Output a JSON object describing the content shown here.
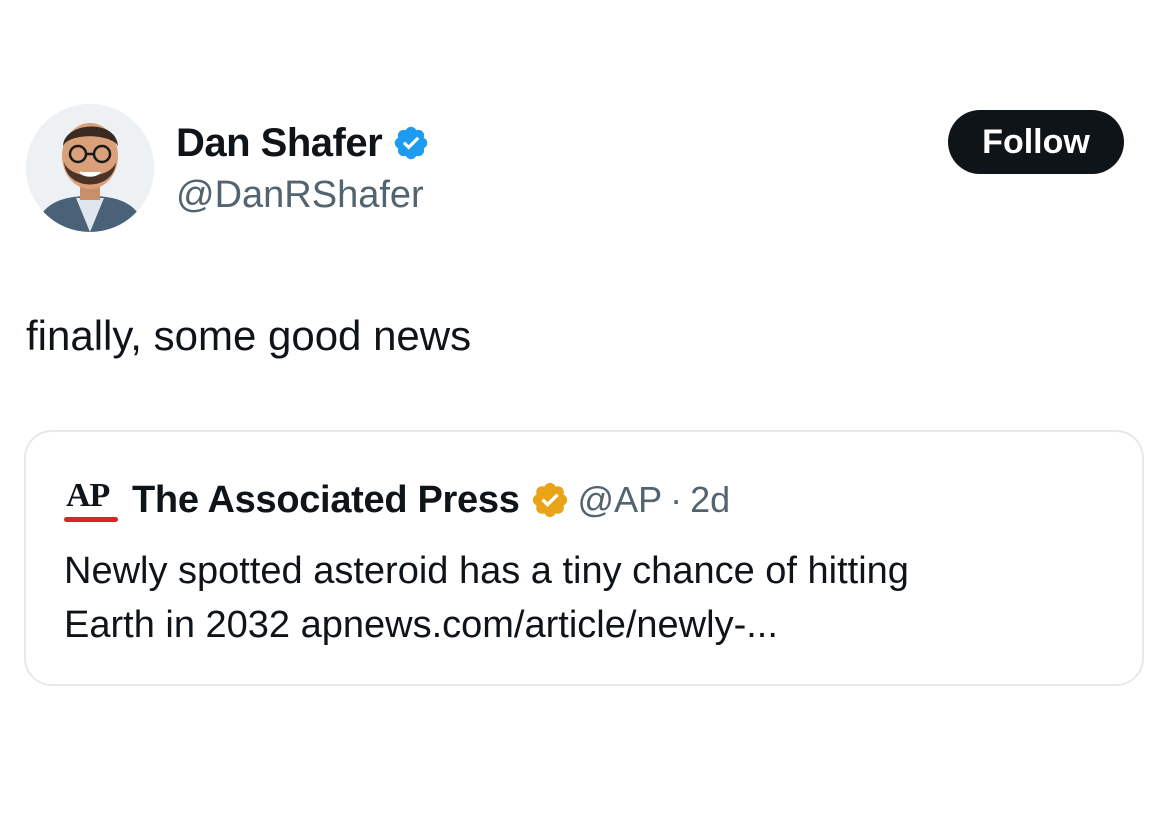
{
  "author": {
    "display_name": "Dan Shafer",
    "handle": "@DanRShafer",
    "verified_badge": "blue-check-icon",
    "avatar_icon": "user-avatar"
  },
  "actions": {
    "follow_label": "Follow"
  },
  "tweet": {
    "text": "finally, some good news"
  },
  "quoted_tweet": {
    "logo_text": "AP",
    "display_name": "The Associated Press",
    "verified_badge": "gold-check-icon",
    "handle": "@AP",
    "separator": "·",
    "time": "2d",
    "body_line1": "Newly spotted asteroid has a tiny chance of hitting",
    "body_line2": "Earth in 2032 apnews.com/article/newly-..."
  },
  "colors": {
    "background": "#ffffff",
    "text_primary": "#0f1419",
    "text_secondary": "#536471",
    "verified_blue": "#1d9bf0",
    "verified_gold": "#e8a317",
    "ap_red": "#e0212a",
    "card_border": "#e6e9ec"
  }
}
